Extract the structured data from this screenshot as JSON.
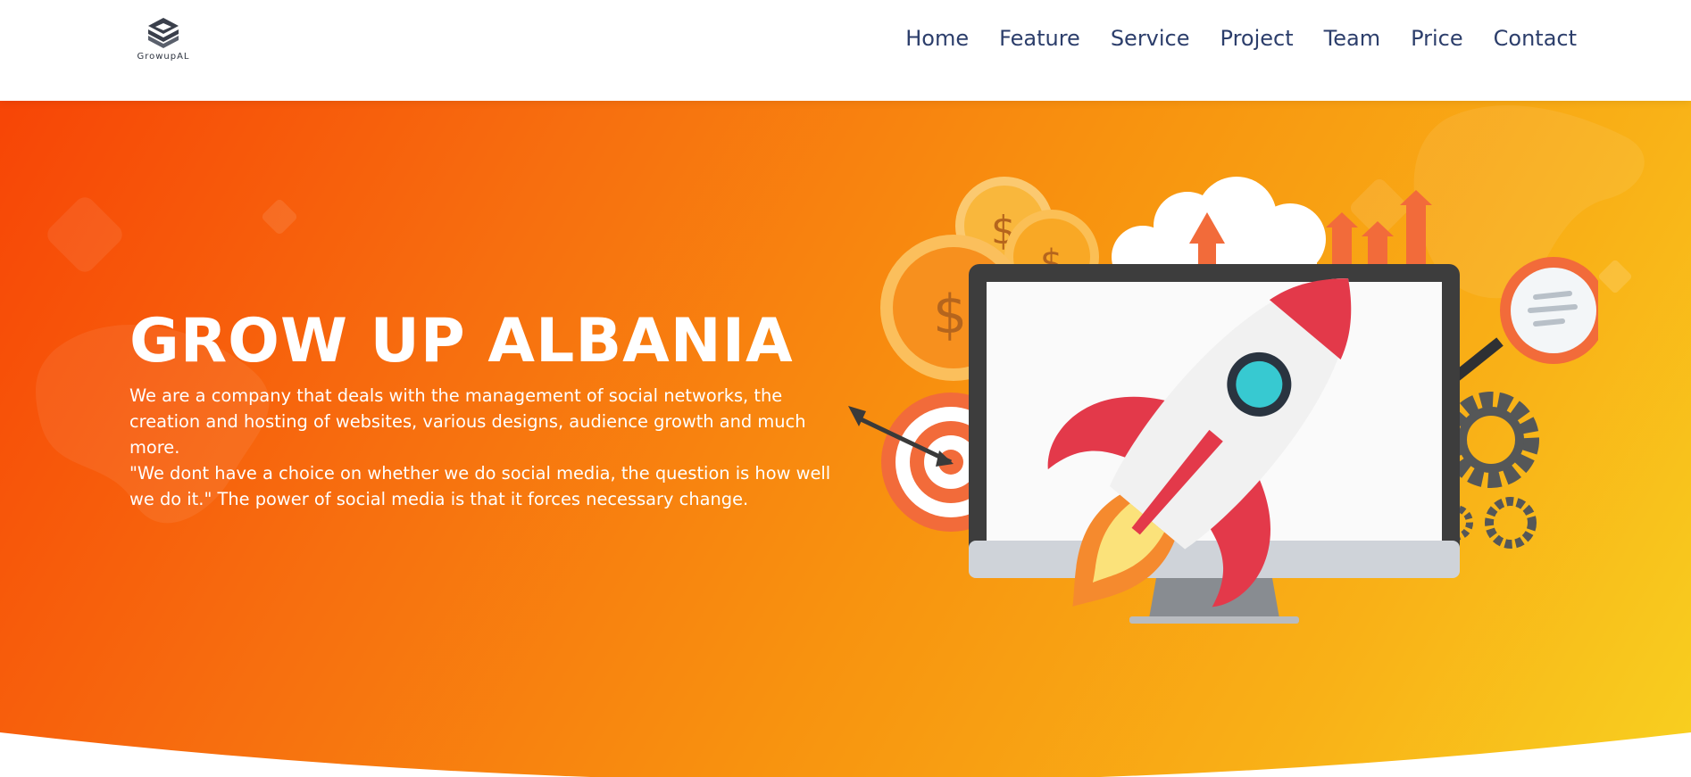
{
  "brand": {
    "logo_text": "GrowupAL"
  },
  "nav": {
    "items": [
      {
        "label": "Home"
      },
      {
        "label": "Feature"
      },
      {
        "label": "Service"
      },
      {
        "label": "Project"
      },
      {
        "label": "Team"
      },
      {
        "label": "Price"
      },
      {
        "label": "Contact"
      }
    ]
  },
  "hero": {
    "title": "GROW UP ALBANIA",
    "description": "We are a company that deals with the management of social networks, the creation and hosting of websites, various designs, audience growth and much more.",
    "quote": "\"We dont have a choice on whether we do social media, the question is how well we do it.\" The power of social media is that it forces necessary change."
  },
  "colors": {
    "gradient_start": "#f74506",
    "gradient_end": "#f8d020",
    "nav_text": "#2c3e6b",
    "hero_text": "#ffffff"
  },
  "icons": [
    "logo-icon",
    "rocket-icon",
    "monitor-icon",
    "dollar-coin-icon",
    "target-icon",
    "cloud-upload-icon",
    "bar-chart-icon",
    "gear-icon",
    "chat-bubble-icon"
  ]
}
